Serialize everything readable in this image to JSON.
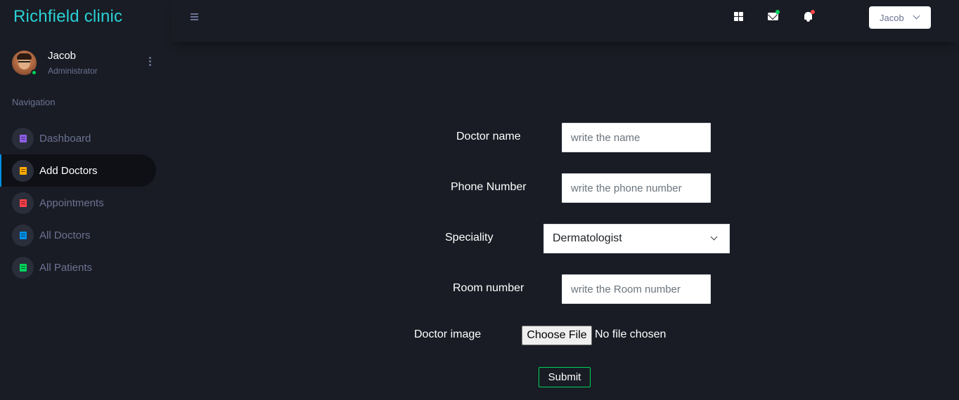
{
  "app": {
    "brand": "Richfield clinic"
  },
  "profile": {
    "name": "Jacob",
    "role": "Administrator"
  },
  "nav": {
    "title": "Navigation",
    "items": [
      {
        "label": "Dashboard",
        "icon": "document-icon",
        "color": "#8f5fe8"
      },
      {
        "label": "Add Doctors",
        "icon": "document-icon",
        "color": "#ffab00",
        "active": true
      },
      {
        "label": "Appointments",
        "icon": "document-icon",
        "color": "#fc424a"
      },
      {
        "label": "All Doctors",
        "icon": "document-icon",
        "color": "#0090e7"
      },
      {
        "label": "All Patients",
        "icon": "document-icon",
        "color": "#00d25b"
      }
    ]
  },
  "topbar": {
    "user_label": "Jacob",
    "icons": [
      "grid-icon",
      "mail-icon",
      "bell-icon"
    ],
    "mail_indicator_color": "#00d25b",
    "bell_indicator_color": "#fc424a"
  },
  "form": {
    "doctor_name": {
      "label": "Doctor name",
      "placeholder": "write the name"
    },
    "phone": {
      "label": "Phone Number",
      "placeholder": "write the phone number"
    },
    "speciality": {
      "label": "Speciality",
      "selected": "Dermatologist"
    },
    "room": {
      "label": "Room number",
      "placeholder": "write the Room number"
    },
    "image": {
      "label": "Doctor image",
      "button": "Choose File",
      "status": "No file chosen"
    },
    "submit": "Submit"
  },
  "colors": {
    "brand": "#2ad1d6",
    "background": "#191c24",
    "submit_border": "#00d25b",
    "active_accent": "#0090e7"
  }
}
